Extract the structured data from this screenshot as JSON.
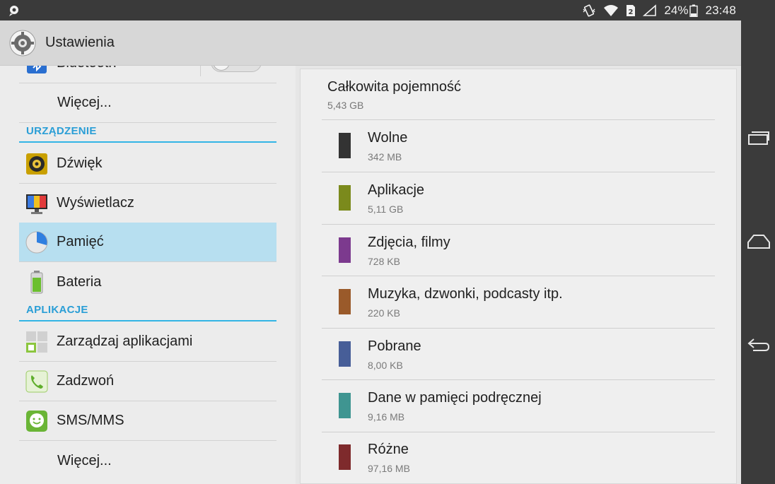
{
  "status_bar": {
    "battery_percent": "24%",
    "time": "23:48"
  },
  "action_bar": {
    "title": "Ustawienia",
    "icon": "gear-icon"
  },
  "sidebar": {
    "items": [
      {
        "label": "Bluetooth",
        "icon": "bluetooth-icon"
      },
      {
        "label": "Więcej..."
      },
      {
        "header": "URZĄDZENIE"
      },
      {
        "label": "Dźwięk",
        "icon": "speaker-icon"
      },
      {
        "label": "Wyświetlacz",
        "icon": "monitor-icon"
      },
      {
        "label": "Pamięć",
        "icon": "pie-chart-icon",
        "selected": true
      },
      {
        "label": "Bateria",
        "icon": "battery-icon"
      },
      {
        "header": "APLIKACJE"
      },
      {
        "label": "Zarządzaj aplikacjami",
        "icon": "apps-grid-icon"
      },
      {
        "label": "Zadzwoń",
        "icon": "phone-icon"
      },
      {
        "label": "SMS/MMS",
        "icon": "sms-icon"
      },
      {
        "label": "Więcej..."
      }
    ]
  },
  "storage": {
    "total_label": "Całkowita pojemność",
    "total_value": "5,43 GB",
    "rows": [
      {
        "name": "Wolne",
        "size": "342 MB",
        "color": "#333333"
      },
      {
        "name": "Aplikacje",
        "size": "5,11 GB",
        "color": "#7b8a1c"
      },
      {
        "name": "Zdjęcia, filmy",
        "size": "728 KB",
        "color": "#7c3a8e"
      },
      {
        "name": "Muzyka, dzwonki, podcasty itp.",
        "size": "220 KB",
        "color": "#9a5a2a"
      },
      {
        "name": "Pobrane",
        "size": "8,00 KB",
        "color": "#475e98"
      },
      {
        "name": "Dane w pamięci podręcznej",
        "size": "9,16 MB",
        "color": "#3f9591"
      },
      {
        "name": "Różne",
        "size": "97,16 MB",
        "color": "#7e2a2c"
      }
    ]
  },
  "colors": {
    "accent": "#33b5e5",
    "selected_bg": "#b7dff0"
  }
}
